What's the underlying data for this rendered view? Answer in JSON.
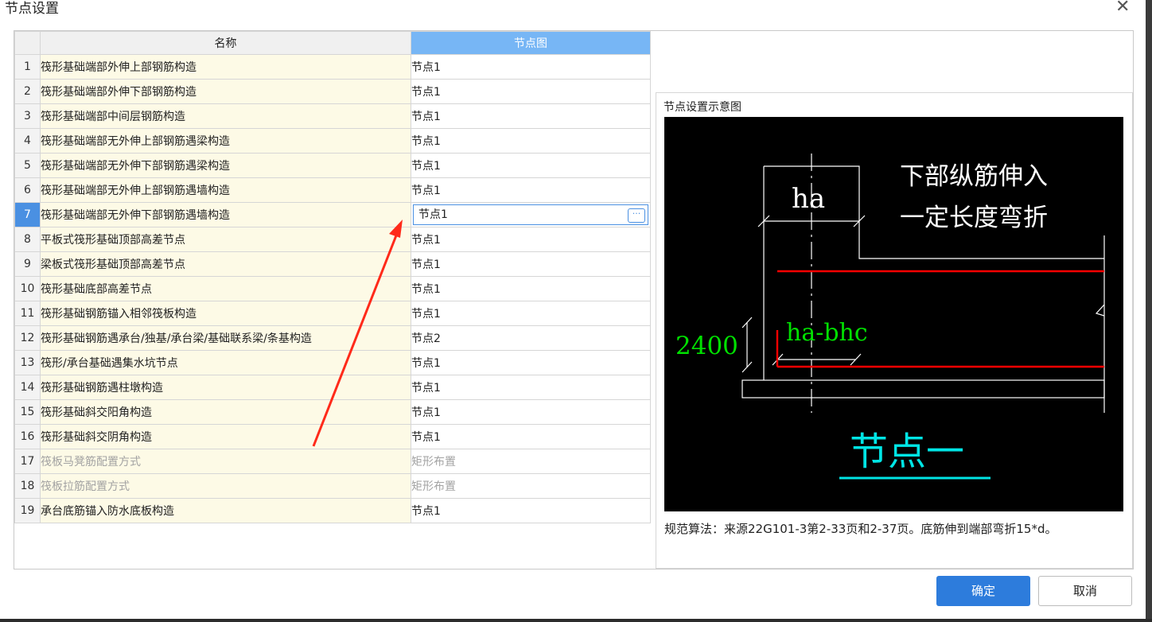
{
  "dialog": {
    "title": "节点设置",
    "close_glyph": "✕"
  },
  "table": {
    "headers": {
      "name": "名称",
      "node": "节点图"
    },
    "rows": [
      {
        "index": "1",
        "name": "筏形基础端部外伸上部钢筋构造",
        "node": "节点1"
      },
      {
        "index": "2",
        "name": "筏形基础端部外伸下部钢筋构造",
        "node": "节点1"
      },
      {
        "index": "3",
        "name": "筏形基础端部中间层钢筋构造",
        "node": "节点1"
      },
      {
        "index": "4",
        "name": "筏形基础端部无外伸上部钢筋遇梁构造",
        "node": "节点1"
      },
      {
        "index": "5",
        "name": "筏形基础端部无外伸下部钢筋遇梁构造",
        "node": "节点1"
      },
      {
        "index": "6",
        "name": "筏形基础端部无外伸上部钢筋遇墙构造",
        "node": "节点1"
      },
      {
        "index": "7",
        "name": "筏形基础端部无外伸下部钢筋遇墙构造",
        "node": "节点1"
      },
      {
        "index": "8",
        "name": "平板式筏形基础顶部高差节点",
        "node": "节点1"
      },
      {
        "index": "9",
        "name": "梁板式筏形基础顶部高差节点",
        "node": "节点1"
      },
      {
        "index": "10",
        "name": "筏形基础底部高差节点",
        "node": "节点1"
      },
      {
        "index": "11",
        "name": "筏形基础钢筋锚入相邻筏板构造",
        "node": "节点1"
      },
      {
        "index": "12",
        "name": "筏形基础钢筋遇承台/独基/承台梁/基础联系梁/条基构造",
        "node": "节点2"
      },
      {
        "index": "13",
        "name": "筏形/承台基础遇集水坑节点",
        "node": "节点1"
      },
      {
        "index": "14",
        "name": "筏形基础钢筋遇柱墩构造",
        "node": "节点1"
      },
      {
        "index": "15",
        "name": "筏形基础斜交阳角构造",
        "node": "节点1"
      },
      {
        "index": "16",
        "name": "筏形基础斜交阴角构造",
        "node": "节点1"
      },
      {
        "index": "17",
        "name": "筏板马凳筋配置方式",
        "node": "矩形布置"
      },
      {
        "index": "18",
        "name": "筏板拉筋配置方式",
        "node": "矩形布置"
      },
      {
        "index": "19",
        "name": "承台底筋锚入防水底板构造",
        "node": "节点1"
      }
    ],
    "selected_index": 7,
    "disabled_indices": [
      17,
      18
    ],
    "more_button_glyph": "···"
  },
  "preview": {
    "title": "节点设置示意图",
    "diagram": {
      "note_line1": "下部纵筋伸入",
      "note_line2": "一定长度弯折",
      "label_ha": "ha",
      "label_ha_bhc": "ha-bhc",
      "label_dim": "2400",
      "label_node": "节点一"
    },
    "description": "规范算法：来源22G101-3第2-33页和2-37页。底筋伸到端部弯折15*d。"
  },
  "buttons": {
    "ok": "确定",
    "cancel": "取消"
  },
  "colors": {
    "accent": "#2d7cdc",
    "header_highlight": "#77b6f5",
    "rebar_red": "#ff0000",
    "dim_green": "#00e000",
    "title_cyan": "#00e5e5"
  }
}
